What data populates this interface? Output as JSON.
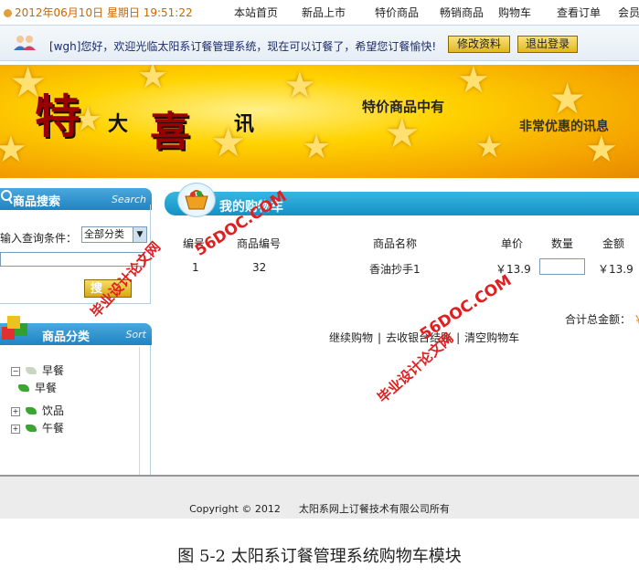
{
  "topbar": {
    "datetime": "2012年06月10日 星期日 19:51:22",
    "nav": [
      "本站首页",
      "新品上市",
      "特价商品",
      "畅销商品",
      "购物车",
      "查看订单",
      "会员"
    ]
  },
  "welcome": {
    "text": "[wgh]您好，欢迎光临太阳系订餐管理系统，现在可以订餐了，希望您订餐愉快!",
    "edit_button": "修改资料",
    "logout_button": "退出登录"
  },
  "banner": {
    "char1": "特",
    "char2": "大",
    "char3": "喜",
    "char4": "讯",
    "line1": "特价商品中有",
    "line2": "非常优惠的讯息"
  },
  "search_panel": {
    "title": "商品搜索",
    "title_en": "Search",
    "label": "输入查询条件：",
    "select_value": "全部分类",
    "button": "搜"
  },
  "category_panel": {
    "title": "商品分类",
    "title_en": "Sort",
    "tree": [
      {
        "label": "早餐",
        "expanded": true
      },
      {
        "label": "早餐",
        "child": true
      },
      {
        "label": "饮品",
        "expanded": false
      },
      {
        "label": "午餐",
        "expanded": false
      }
    ]
  },
  "cart": {
    "title": "我的购物车",
    "columns": [
      "编号",
      "商品编号",
      "商品名称",
      "单价",
      "数量",
      "金额"
    ],
    "rows": [
      {
        "no": "1",
        "product_id": "32",
        "name": "香油抄手1",
        "price": "￥13.9",
        "quantity": "",
        "amount": "￥13.9"
      }
    ],
    "total_label": "合计总金额：",
    "total_value": "￥",
    "actions": [
      "继续购物",
      "去收银台结账",
      "清空购物车"
    ],
    "separator": "|"
  },
  "footer": {
    "copyright": "Copyright © 2012",
    "company": "太阳系网上订餐技术有限公司所有"
  },
  "caption": "图 5-2 太阳系订餐管理系统购物车模块",
  "watermark": {
    "site": "56DOC.COM",
    "cn": "毕业设计论文网"
  },
  "colors": {
    "accent_blue": "#1f84c4",
    "button_yellow": "#e0b820",
    "clock_orange": "#cc6600",
    "watermark_red": "#e02020"
  }
}
